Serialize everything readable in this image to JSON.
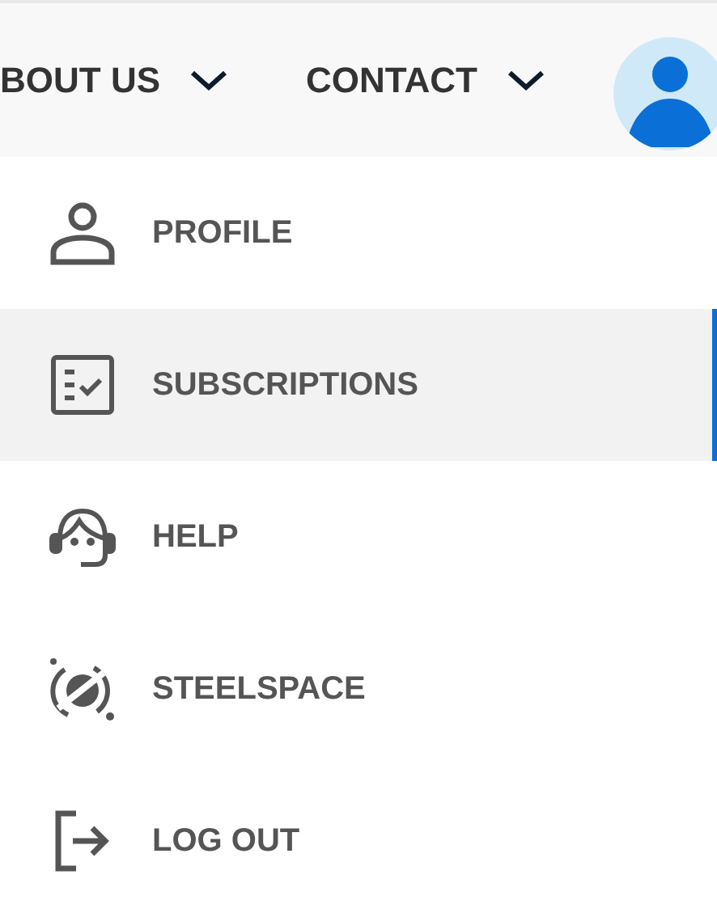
{
  "nav": [
    {
      "label": "BOUT US",
      "expanded": false
    },
    {
      "label": "CONTACT",
      "expanded": false
    }
  ],
  "menu": [
    {
      "kind": "profile",
      "label": "PROFILE",
      "selected": false
    },
    {
      "kind": "subscriptions",
      "label": "SUBSCRIPTIONS",
      "selected": true
    },
    {
      "kind": "help",
      "label": "HELP",
      "selected": false
    },
    {
      "kind": "steelspace",
      "label": "STEELSPACE",
      "selected": false
    },
    {
      "kind": "logout",
      "label": "LOG OUT",
      "selected": false
    }
  ]
}
